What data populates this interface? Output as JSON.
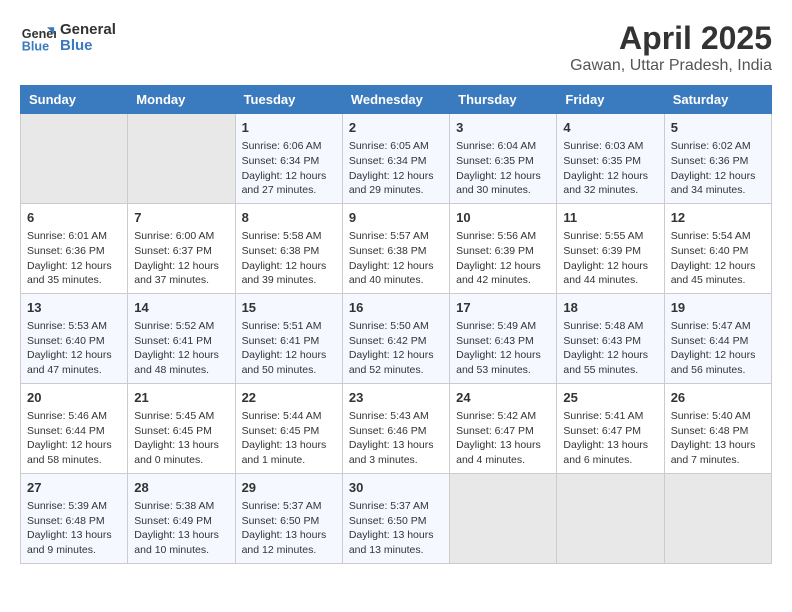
{
  "header": {
    "logo_line1": "General",
    "logo_line2": "Blue",
    "main_title": "April 2025",
    "subtitle": "Gawan, Uttar Pradesh, India"
  },
  "days_of_week": [
    "Sunday",
    "Monday",
    "Tuesday",
    "Wednesday",
    "Thursday",
    "Friday",
    "Saturday"
  ],
  "weeks": [
    [
      {
        "day": "",
        "info": ""
      },
      {
        "day": "",
        "info": ""
      },
      {
        "day": "1",
        "info": "Sunrise: 6:06 AM\nSunset: 6:34 PM\nDaylight: 12 hours and 27 minutes."
      },
      {
        "day": "2",
        "info": "Sunrise: 6:05 AM\nSunset: 6:34 PM\nDaylight: 12 hours and 29 minutes."
      },
      {
        "day": "3",
        "info": "Sunrise: 6:04 AM\nSunset: 6:35 PM\nDaylight: 12 hours and 30 minutes."
      },
      {
        "day": "4",
        "info": "Sunrise: 6:03 AM\nSunset: 6:35 PM\nDaylight: 12 hours and 32 minutes."
      },
      {
        "day": "5",
        "info": "Sunrise: 6:02 AM\nSunset: 6:36 PM\nDaylight: 12 hours and 34 minutes."
      }
    ],
    [
      {
        "day": "6",
        "info": "Sunrise: 6:01 AM\nSunset: 6:36 PM\nDaylight: 12 hours and 35 minutes."
      },
      {
        "day": "7",
        "info": "Sunrise: 6:00 AM\nSunset: 6:37 PM\nDaylight: 12 hours and 37 minutes."
      },
      {
        "day": "8",
        "info": "Sunrise: 5:58 AM\nSunset: 6:38 PM\nDaylight: 12 hours and 39 minutes."
      },
      {
        "day": "9",
        "info": "Sunrise: 5:57 AM\nSunset: 6:38 PM\nDaylight: 12 hours and 40 minutes."
      },
      {
        "day": "10",
        "info": "Sunrise: 5:56 AM\nSunset: 6:39 PM\nDaylight: 12 hours and 42 minutes."
      },
      {
        "day": "11",
        "info": "Sunrise: 5:55 AM\nSunset: 6:39 PM\nDaylight: 12 hours and 44 minutes."
      },
      {
        "day": "12",
        "info": "Sunrise: 5:54 AM\nSunset: 6:40 PM\nDaylight: 12 hours and 45 minutes."
      }
    ],
    [
      {
        "day": "13",
        "info": "Sunrise: 5:53 AM\nSunset: 6:40 PM\nDaylight: 12 hours and 47 minutes."
      },
      {
        "day": "14",
        "info": "Sunrise: 5:52 AM\nSunset: 6:41 PM\nDaylight: 12 hours and 48 minutes."
      },
      {
        "day": "15",
        "info": "Sunrise: 5:51 AM\nSunset: 6:41 PM\nDaylight: 12 hours and 50 minutes."
      },
      {
        "day": "16",
        "info": "Sunrise: 5:50 AM\nSunset: 6:42 PM\nDaylight: 12 hours and 52 minutes."
      },
      {
        "day": "17",
        "info": "Sunrise: 5:49 AM\nSunset: 6:43 PM\nDaylight: 12 hours and 53 minutes."
      },
      {
        "day": "18",
        "info": "Sunrise: 5:48 AM\nSunset: 6:43 PM\nDaylight: 12 hours and 55 minutes."
      },
      {
        "day": "19",
        "info": "Sunrise: 5:47 AM\nSunset: 6:44 PM\nDaylight: 12 hours and 56 minutes."
      }
    ],
    [
      {
        "day": "20",
        "info": "Sunrise: 5:46 AM\nSunset: 6:44 PM\nDaylight: 12 hours and 58 minutes."
      },
      {
        "day": "21",
        "info": "Sunrise: 5:45 AM\nSunset: 6:45 PM\nDaylight: 13 hours and 0 minutes."
      },
      {
        "day": "22",
        "info": "Sunrise: 5:44 AM\nSunset: 6:45 PM\nDaylight: 13 hours and 1 minute."
      },
      {
        "day": "23",
        "info": "Sunrise: 5:43 AM\nSunset: 6:46 PM\nDaylight: 13 hours and 3 minutes."
      },
      {
        "day": "24",
        "info": "Sunrise: 5:42 AM\nSunset: 6:47 PM\nDaylight: 13 hours and 4 minutes."
      },
      {
        "day": "25",
        "info": "Sunrise: 5:41 AM\nSunset: 6:47 PM\nDaylight: 13 hours and 6 minutes."
      },
      {
        "day": "26",
        "info": "Sunrise: 5:40 AM\nSunset: 6:48 PM\nDaylight: 13 hours and 7 minutes."
      }
    ],
    [
      {
        "day": "27",
        "info": "Sunrise: 5:39 AM\nSunset: 6:48 PM\nDaylight: 13 hours and 9 minutes."
      },
      {
        "day": "28",
        "info": "Sunrise: 5:38 AM\nSunset: 6:49 PM\nDaylight: 13 hours and 10 minutes."
      },
      {
        "day": "29",
        "info": "Sunrise: 5:37 AM\nSunset: 6:50 PM\nDaylight: 13 hours and 12 minutes."
      },
      {
        "day": "30",
        "info": "Sunrise: 5:37 AM\nSunset: 6:50 PM\nDaylight: 13 hours and 13 minutes."
      },
      {
        "day": "",
        "info": ""
      },
      {
        "day": "",
        "info": ""
      },
      {
        "day": "",
        "info": ""
      }
    ]
  ]
}
